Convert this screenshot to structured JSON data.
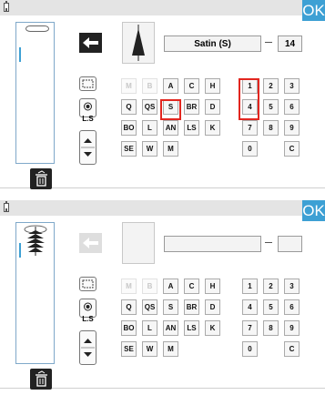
{
  "ok_label": "OK",
  "colors": {
    "accent": "#3da0d4",
    "highlight": "#e2261f"
  },
  "icons": {
    "battery": "battery-icon",
    "arrow_left": "arrow-left-icon",
    "select_frame": "dashed-frame-icon",
    "ls_radio": "ls-radio-icon",
    "up": "arrow-up-icon",
    "down": "arrow-down-icon",
    "trash": "trash-icon",
    "stitch": "stitch-preview-icon"
  },
  "ls_label": "L.S",
  "panel1": {
    "stitch_name": "Satin (S)",
    "stitch_number": "14",
    "highlighted_keys": [
      "S",
      "1",
      "4"
    ]
  },
  "panel2": {
    "stitch_name": "",
    "stitch_number": ""
  },
  "keys": {
    "rows": [
      [
        "M",
        "B",
        "A",
        "C",
        "H"
      ],
      [
        "Q",
        "QS",
        "S",
        "BR",
        "D"
      ],
      [
        "BO",
        "L",
        "AN",
        "LS",
        "K"
      ],
      [
        "SE",
        "W",
        "M"
      ]
    ],
    "disabled": [
      "M",
      "B"
    ],
    "numpad": [
      [
        "1",
        "2",
        "3"
      ],
      [
        "4",
        "5",
        "6"
      ],
      [
        "7",
        "8",
        "9"
      ],
      [
        "0",
        "",
        "C"
      ]
    ]
  }
}
